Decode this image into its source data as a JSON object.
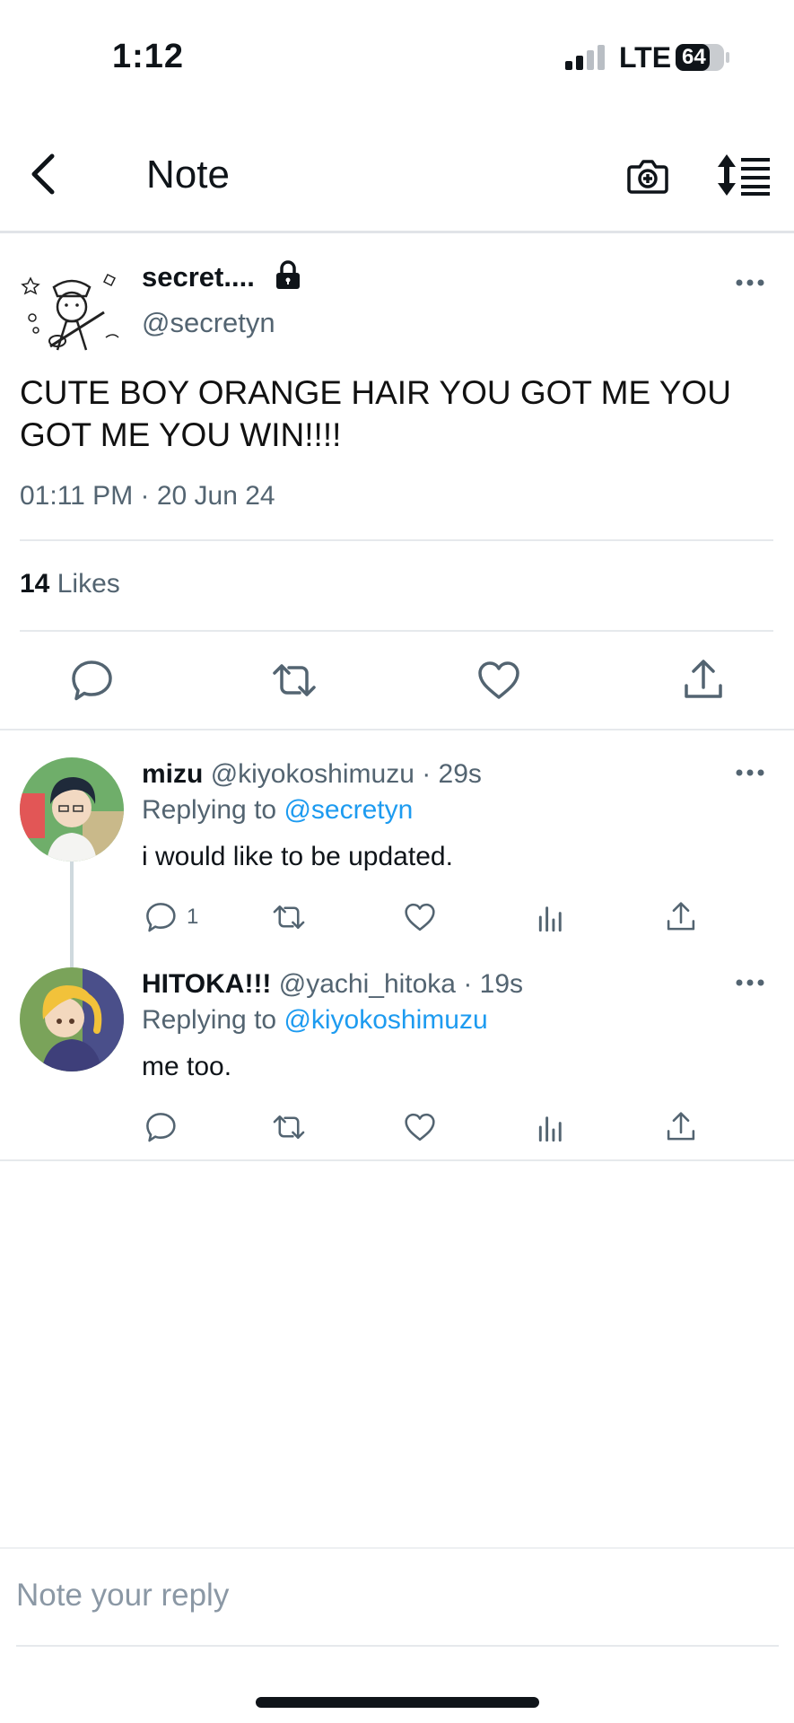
{
  "status_bar": {
    "time": "1:12",
    "network": "LTE",
    "battery": "64"
  },
  "nav": {
    "title": "Note"
  },
  "note": {
    "author_name": "secret....",
    "author_handle": "@secretyn",
    "text": "CUTE BOY ORANGE HAIR YOU GOT ME YOU GOT ME YOU WIN!!!!",
    "timestamp": "01:11 PM · 20 Jun 24",
    "likes_count": "14",
    "likes_label": "Likes"
  },
  "replies": [
    {
      "name": "mizu",
      "handle": "@kiyokoshimuzu",
      "time": "· 29s",
      "replying_prefix": "Replying to",
      "replying_to": "@secretyn",
      "text": "i would like to be updated.",
      "reply_count": "1"
    },
    {
      "name": "HITOKA!!!",
      "handle": "@yachi_hitoka",
      "time": "· 19s",
      "replying_prefix": "Replying to",
      "replying_to": "@kiyokoshimuzu",
      "text": "me too.",
      "reply_count": ""
    }
  ],
  "composer": {
    "placeholder": "Note your reply"
  },
  "colors": {
    "accent": "#1d9bf0",
    "secondary_text": "#536471",
    "divider": "#e6e9ec"
  }
}
